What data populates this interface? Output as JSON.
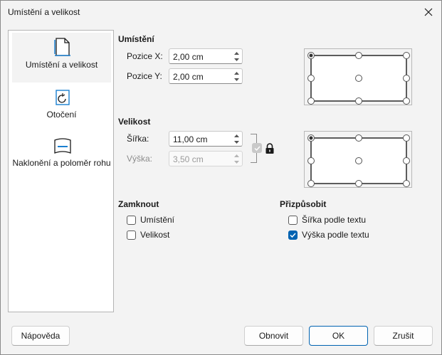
{
  "window": {
    "title": "Umístění a velikost"
  },
  "sidebar": {
    "items": [
      {
        "label": "Umístění a velikost",
        "icon": "page-icon",
        "active": true
      },
      {
        "label": "Otočení",
        "icon": "rotate-icon",
        "active": false
      },
      {
        "label": "Naklonění a poloměr rohu",
        "icon": "slant-icon",
        "active": false
      }
    ]
  },
  "position": {
    "title": "Umístění",
    "x_label": "Pozice X:",
    "x_value": "2,00 cm",
    "y_label": "Pozice Y:",
    "y_value": "2,00 cm"
  },
  "size": {
    "title": "Velikost",
    "width_label": "Šířka:",
    "width_value": "11,00 cm",
    "height_label": "Výška:",
    "height_value": "3,50 cm"
  },
  "lock": {
    "title": "Zamknout",
    "position_label": "Umístění",
    "position_checked": false,
    "size_label": "Velikost",
    "size_checked": false
  },
  "fit": {
    "title": "Přizpůsobit",
    "width_label": "Šířka podle textu",
    "width_checked": false,
    "height_label": "Výška podle textu",
    "height_checked": true
  },
  "buttons": {
    "help": "Nápověda",
    "reset": "Obnovit",
    "ok": "OK",
    "cancel": "Zrušit"
  },
  "colors": {
    "accent": "#0063b1",
    "window_bg": "#f3f3f3"
  }
}
